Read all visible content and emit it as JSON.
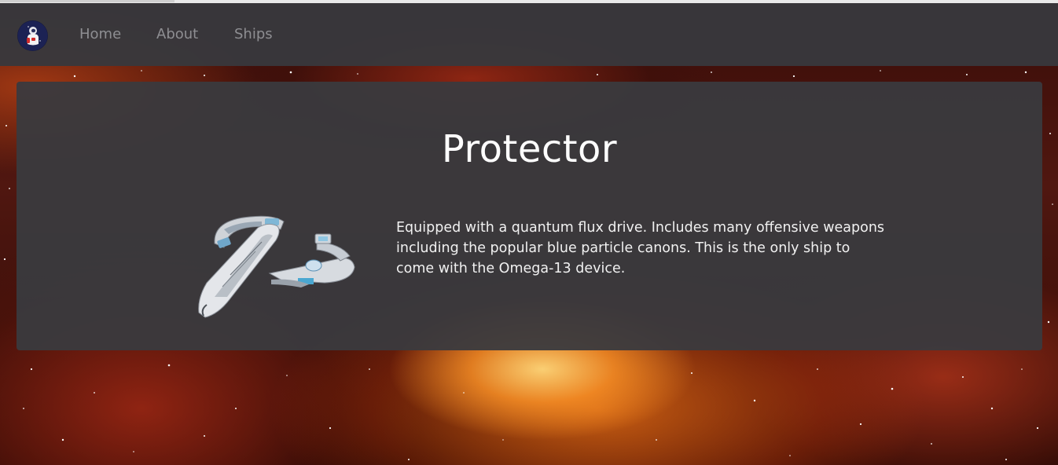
{
  "nav": {
    "logo_icon": "astronaut-logo-icon",
    "links": [
      {
        "label": "Home"
      },
      {
        "label": "About"
      },
      {
        "label": "Ships"
      }
    ]
  },
  "ship": {
    "name": "Protector",
    "image_icon": "spaceship-image",
    "description": "Equipped with a quantum flux drive. Includes many offensive weapons including the popular blue particle canons. This is the only ship to come with the Omega-13 device."
  },
  "colors": {
    "navbar_bg": "#38383c",
    "card_bg": "#3a3a3e",
    "nav_text": "#8e8e92",
    "title_text": "#ffffff",
    "body_text": "#f1f1f1"
  }
}
